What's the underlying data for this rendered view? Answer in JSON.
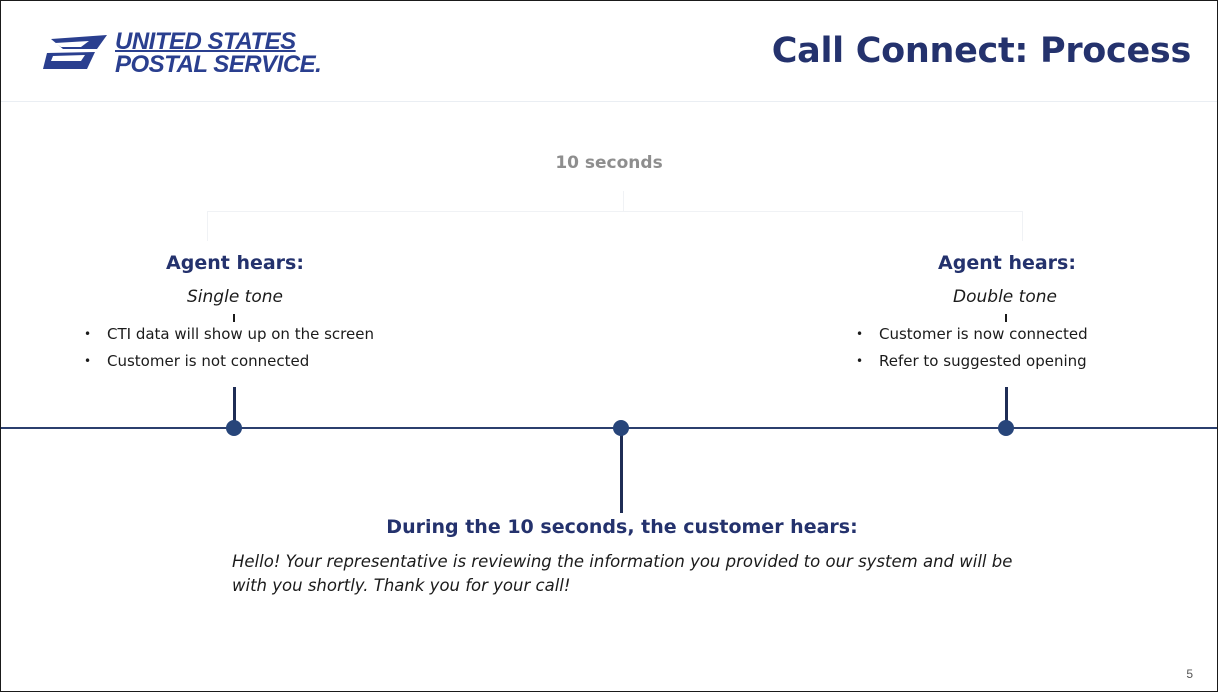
{
  "header": {
    "logo": {
      "line1": "UNITED STATES",
      "line2": "POSTAL SERVICE.",
      "icon": "usps-eagle-icon"
    },
    "title": "Call Connect: Process"
  },
  "timeline": {
    "duration_label": "10 seconds",
    "left_event": {
      "heading": "Agent hears:",
      "tone": "Single tone",
      "bullets": [
        "CTI data will show up on the screen",
        "Customer is not connected"
      ]
    },
    "right_event": {
      "heading": "Agent hears:",
      "tone": "Double tone",
      "bullets": [
        "Customer is now connected",
        "Refer to suggested opening"
      ]
    },
    "middle_event": {
      "heading": "During the 10 seconds, the customer hears:",
      "message": "Hello! Your representative is reviewing the information you provided to our system and will be with you shortly. Thank you for your call!"
    }
  },
  "page_number": "5",
  "colors": {
    "navy": "#24326d",
    "logo_blue": "#2a3f8f",
    "timeline": "#2b3f6e",
    "node": "#27457a",
    "muted": "#8e8e8e"
  }
}
